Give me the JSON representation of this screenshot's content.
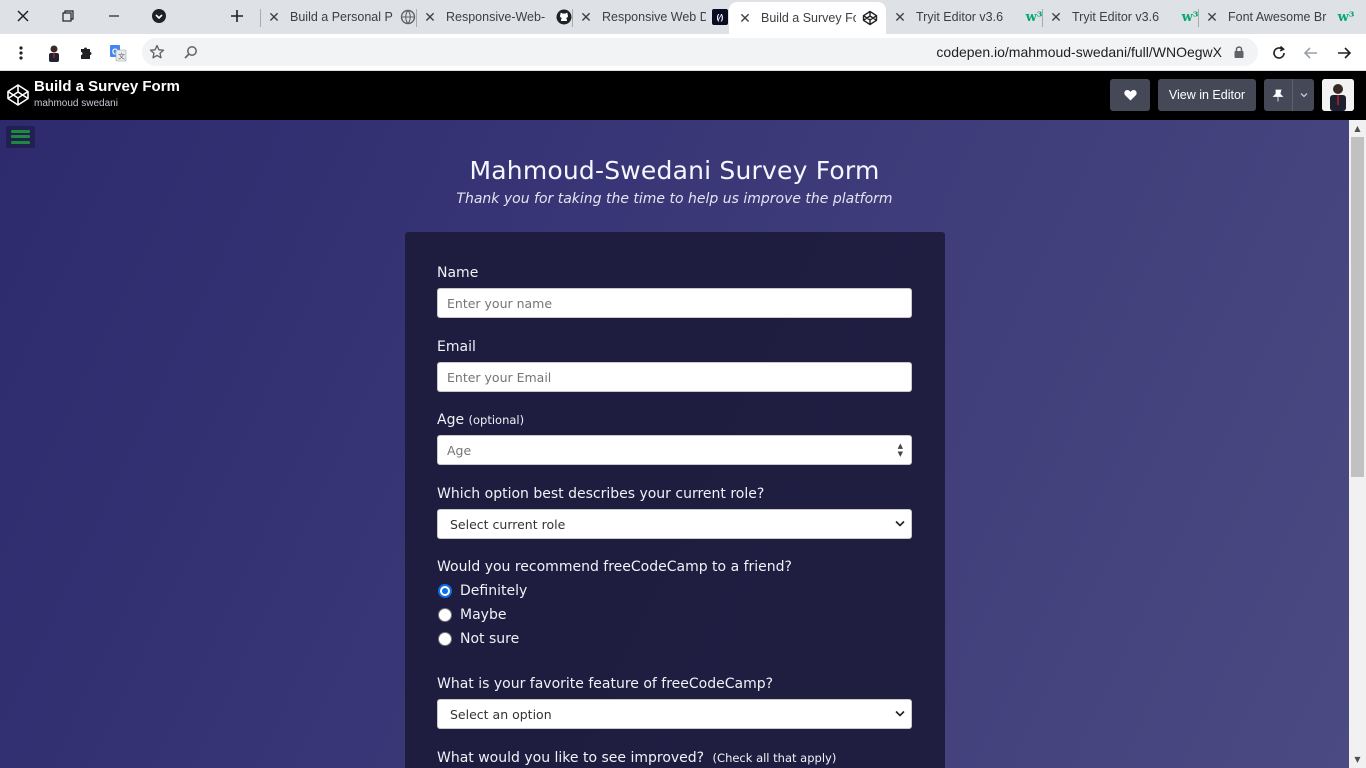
{
  "browser": {
    "tabs": [
      {
        "title": "Build a Personal P",
        "favicon": "globe-icon"
      },
      {
        "title": "Responsive-Web-",
        "favicon": "github-icon"
      },
      {
        "title": "Responsive Web D",
        "favicon": "fcc-icon"
      },
      {
        "title": "Build a Survey Fo",
        "favicon": "codepen-icon",
        "active": true
      },
      {
        "title": "Tryit Editor v3.6",
        "favicon": "w3schools-icon"
      },
      {
        "title": "Tryit Editor v3.6",
        "favicon": "w3schools-icon"
      },
      {
        "title": "Font Awesome Br",
        "favicon": "w3schools-icon"
      }
    ],
    "url": "codepen.io/mahmoud-swedani/full/WNOegwX"
  },
  "codepen": {
    "pen_title": "Build a Survey Form",
    "author": "mahmoud swedani",
    "view_in_editor": "View in Editor"
  },
  "survey": {
    "title": "Mahmoud-Swedani Survey Form",
    "description": "Thank you for taking the time to help us improve the platform",
    "name_label": "Name",
    "name_placeholder": "Enter your name",
    "email_label": "Email",
    "email_placeholder": "Enter your Email",
    "age_label": "Age",
    "age_optional": "(optional)",
    "age_placeholder": "Age",
    "role_label": "Which option best describes your current role?",
    "role_selected": "Select current role",
    "recommend_label": "Would you recommend freeCodeCamp to a friend?",
    "recommend_options": [
      "Definitely",
      "Maybe",
      "Not sure"
    ],
    "recommend_selected": "Definitely",
    "feature_label": "What is your favorite feature of freeCodeCamp?",
    "feature_selected": "Select an option",
    "improve_label": "What would you like to see improved?",
    "improve_hint": "(Check all that apply)"
  },
  "colors": {
    "page_gradient_start": "#2d2a6e",
    "page_gradient_end": "#4b4a82",
    "form_card": "#1c1b3c",
    "radio_accent": "#0b6ee8",
    "hamburger": "#1e8a3d"
  }
}
